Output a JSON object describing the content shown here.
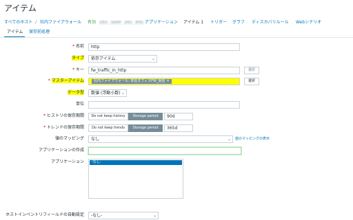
{
  "page": {
    "title": "アイテム"
  },
  "breadcrumb": {
    "all_hosts": "すべてのホスト",
    "separator": "/",
    "host": "社内ファイアウォール",
    "status": "有効",
    "tags": [
      "ZBX",
      "SNMP",
      "JMX",
      "IPMI"
    ],
    "links": [
      {
        "label": "アプリケーション",
        "active": false
      },
      {
        "label": "アイテム 1",
        "active": true
      },
      {
        "label": "トリガー",
        "active": false
      },
      {
        "label": "グラフ",
        "active": false
      },
      {
        "label": "ディスカバリルール",
        "active": false
      },
      {
        "label": "Webシナリオ",
        "active": false
      }
    ]
  },
  "tabs": [
    {
      "label": "アイテム",
      "active": true
    },
    {
      "label": "保存前処理",
      "active": false
    }
  ],
  "form": {
    "name": {
      "label": "名前",
      "required": true,
      "value": "http"
    },
    "type": {
      "label": "タイプ",
      "value": "依存アイテム"
    },
    "key": {
      "label": "キー",
      "required": true,
      "value": "fw_traffic_in_http",
      "button": "選択"
    },
    "master_item": {
      "label": "マスターアイテム",
      "required": true,
      "value": "社内ファイアウォール: 本社オフィスFW_受信",
      "remove": "✕",
      "button": "選択"
    },
    "data_type": {
      "label": "データ型",
      "value": "数値 (浮動小数)"
    },
    "unit": {
      "label": "単位",
      "value": ""
    },
    "history": {
      "label": "ヒストリの保存期間",
      "required": true,
      "option_off": "Do not keep history",
      "option_on": "Storage period",
      "value": "90d"
    },
    "trends": {
      "label": "トレンドの保存期間",
      "required": true,
      "option_off": "Do not keep trends",
      "option_on": "Storage period",
      "value": "365d"
    },
    "value_mapping": {
      "label": "値のマッピング",
      "value": "なし",
      "link": "値のマッピングの表示"
    },
    "new_application": {
      "label": "アプリケーションの作成",
      "value": ""
    },
    "applications": {
      "label": "アプリケーション",
      "selected": "-なし-"
    },
    "inventory_field": {
      "label": "ホストインベントリフィールドの自動設定",
      "value": "-なし-"
    }
  },
  "colors": {
    "accent": "#0275b8",
    "highlight": "#ffff00",
    "status_green": "#429e47",
    "segment_on": "#768d99"
  }
}
